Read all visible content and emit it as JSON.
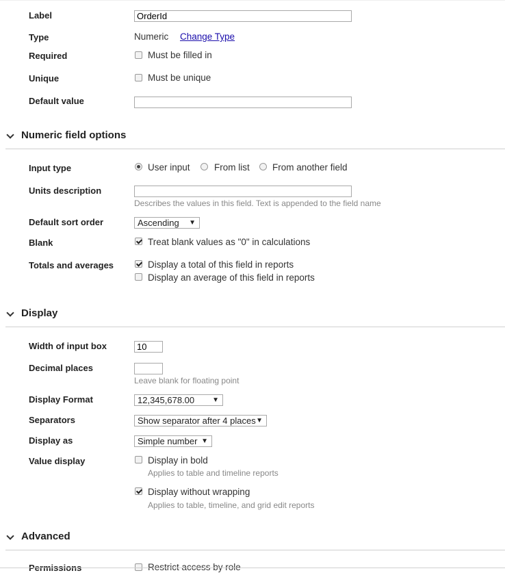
{
  "general": {
    "label_label": "Label",
    "label_value": "OrderId",
    "type_label": "Type",
    "type_value": "Numeric",
    "change_type_link": "Change Type",
    "required_label": "Required",
    "required_option": "Must be filled in",
    "unique_label": "Unique",
    "unique_option": "Must be unique",
    "default_label": "Default value",
    "default_value": ""
  },
  "numeric": {
    "title": "Numeric field options",
    "input_type_label": "Input type",
    "input_types": [
      "User input",
      "From list",
      "From another field"
    ],
    "input_type_selected": "User input",
    "units_label": "Units description",
    "units_value": "",
    "units_hint": "Describes the values in this field. Text is appended to the field name",
    "sort_label": "Default sort order",
    "sort_value": "Ascending",
    "blank_label": "Blank",
    "blank_option": "Treat blank values as \"0\" in calculations",
    "blank_checked": true,
    "totals_label": "Totals and averages",
    "totals_option": "Display a total of this field in reports",
    "totals_checked": true,
    "average_option": "Display an average of this field in reports",
    "average_checked": false
  },
  "display": {
    "title": "Display",
    "width_label": "Width of input box",
    "width_value": "10",
    "decimal_label": "Decimal places",
    "decimal_value": "",
    "decimal_hint": "Leave blank for floating point",
    "format_label": "Display Format",
    "format_value": "12,345,678.00",
    "separators_label": "Separators",
    "separators_value": "Show separator after 4 places",
    "display_as_label": "Display as",
    "display_as_value": "Simple number",
    "value_display_label": "Value display",
    "bold_option": "Display in bold",
    "bold_checked": false,
    "bold_hint": "Applies to table and timeline reports",
    "nowrap_option": "Display without wrapping",
    "nowrap_checked": true,
    "nowrap_hint": "Applies to table, timeline, and grid edit reports"
  },
  "advanced": {
    "title": "Advanced",
    "permissions_label": "Permissions",
    "permissions_option": "Restrict access by role"
  },
  "icons": {
    "section_toggle": "chevron-down-icon",
    "select_arrow": "triangle-down-icon"
  }
}
